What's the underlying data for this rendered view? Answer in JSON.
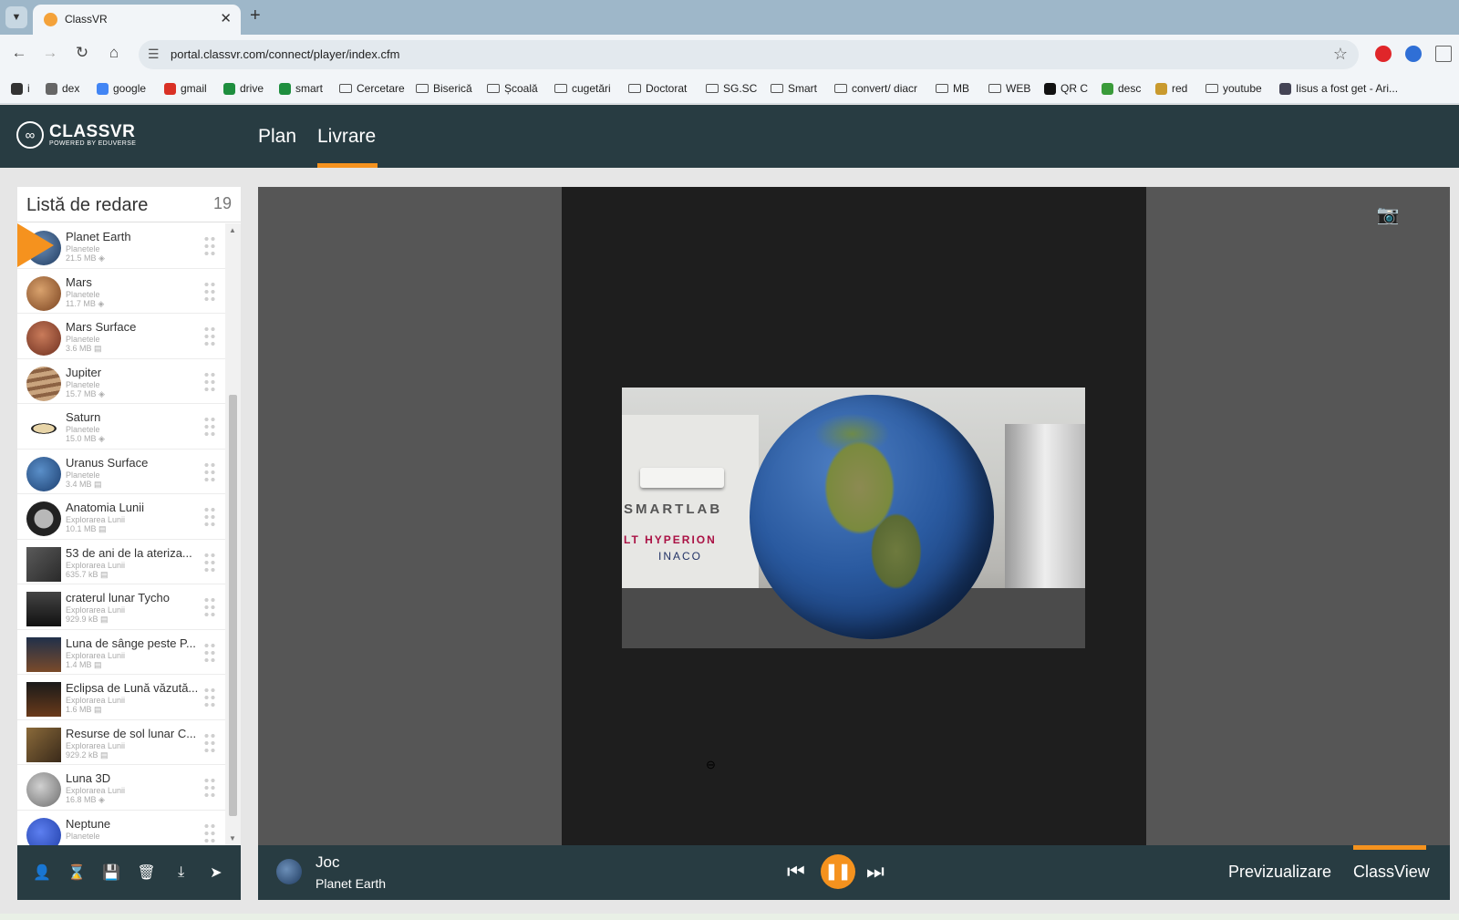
{
  "browser": {
    "tab_title": "ClassVR",
    "close_glyph": "✕",
    "new_tab_glyph": "+",
    "url": "portal.classvr.com/connect/player/index.cfm",
    "bookmarks": [
      {
        "label": "i",
        "icon": "apple-icon"
      },
      {
        "label": "dex",
        "icon": "dex-icon"
      },
      {
        "label": "google",
        "icon": "google-icon"
      },
      {
        "label": "gmail",
        "icon": "gmail-icon"
      },
      {
        "label": "drive",
        "icon": "drive-icon"
      },
      {
        "label": "smart",
        "icon": "drive-icon"
      },
      {
        "label": "Cercetare",
        "icon": "folder-icon"
      },
      {
        "label": "Biserică",
        "icon": "folder-icon"
      },
      {
        "label": "Școală",
        "icon": "folder-icon"
      },
      {
        "label": "cugetări",
        "icon": "folder-icon"
      },
      {
        "label": "Doctorat",
        "icon": "folder-icon"
      },
      {
        "label": "SG.SC",
        "icon": "folder-icon"
      },
      {
        "label": "Smart",
        "icon": "folder-icon"
      },
      {
        "label": "convert/ diacr",
        "icon": "folder-icon"
      },
      {
        "label": "MB",
        "icon": "folder-icon"
      },
      {
        "label": "WEB",
        "icon": "folder-icon"
      },
      {
        "label": "QR C",
        "icon": "qr-icon"
      },
      {
        "label": "desc",
        "icon": "download-icon"
      },
      {
        "label": "red",
        "icon": "red-icon"
      },
      {
        "label": "youtube",
        "icon": "folder-icon"
      },
      {
        "label": "Iisus a fost get - Ari...",
        "icon": "page-icon"
      }
    ]
  },
  "app": {
    "logo_text": "CLASSVR",
    "logo_sub": "POWERED BY EDUVERSE",
    "nav": {
      "plan": "Plan",
      "livrare": "Livrare",
      "active": "Livrare"
    },
    "accent_color": "#f5921e",
    "header_color": "#283c42"
  },
  "playlist": {
    "title": "Listă de redare",
    "count": "19",
    "items": [
      {
        "name": "Planet Earth",
        "category": "Planetele",
        "size": "21.5 MB",
        "icon": "360-icon",
        "thumb": "earth",
        "playing": true
      },
      {
        "name": "Mars",
        "category": "Planetele",
        "size": "11.7 MB",
        "icon": "360-icon",
        "thumb": "mars"
      },
      {
        "name": "Mars Surface",
        "category": "Planetele",
        "size": "3.6 MB",
        "icon": "image-icon",
        "thumb": "mars-surface"
      },
      {
        "name": "Jupiter",
        "category": "Planetele",
        "size": "15.7 MB",
        "icon": "360-icon",
        "thumb": "jupiter"
      },
      {
        "name": "Saturn",
        "category": "Planetele",
        "size": "15.0 MB",
        "icon": "360-icon",
        "thumb": "saturn"
      },
      {
        "name": "Uranus Surface",
        "category": "Planetele",
        "size": "3.4 MB",
        "icon": "image-icon",
        "thumb": "uranus"
      },
      {
        "name": "Anatomia Lunii",
        "category": "Explorarea Lunii",
        "size": "10.1 MB",
        "icon": "image-icon",
        "thumb": "moon-anatomy"
      },
      {
        "name": "53 de ani de la ateriza...",
        "category": "Explorarea Lunii",
        "size": "635.7 kB",
        "icon": "image-icon",
        "thumb": "moon-landing"
      },
      {
        "name": "craterul lunar Tycho",
        "category": "Explorarea Lunii",
        "size": "929.9 kB",
        "icon": "image-icon",
        "thumb": "tycho"
      },
      {
        "name": "Luna de sânge peste P...",
        "category": "Explorarea Lunii",
        "size": "1.4 MB",
        "icon": "image-icon",
        "thumb": "blood-moon"
      },
      {
        "name": "Eclipsa de Lună văzută...",
        "category": "Explorarea Lunii",
        "size": "1.6 MB",
        "icon": "image-icon",
        "thumb": "eclipse"
      },
      {
        "name": "Resurse de sol lunar C...",
        "category": "Explorarea Lunii",
        "size": "929.2 kB",
        "icon": "image-icon",
        "thumb": "soil"
      },
      {
        "name": "Luna 3D",
        "category": "Explorarea Lunii",
        "size": "16.8 MB",
        "icon": "360-icon",
        "thumb": "moon3d"
      },
      {
        "name": "Neptune",
        "category": "Planetele",
        "size": "",
        "icon": "",
        "thumb": "neptune"
      }
    ],
    "tools": [
      "user-icon",
      "hourglass-icon",
      "save-icon",
      "trash-icon",
      "download-icon",
      "send-icon"
    ]
  },
  "player": {
    "now_playing_type": "Joc",
    "now_playing_title": "Planet Earth",
    "controls": {
      "prev": "previous-icon",
      "pause": "pause-icon",
      "next": "next-icon"
    },
    "scene_texts": {
      "line1": "SMARTLAB",
      "line2": "LT HYPERION",
      "line3": "INACO"
    },
    "view_modes": {
      "preview": "Previzualizare",
      "classview": "ClassView",
      "active": "ClassView"
    }
  }
}
